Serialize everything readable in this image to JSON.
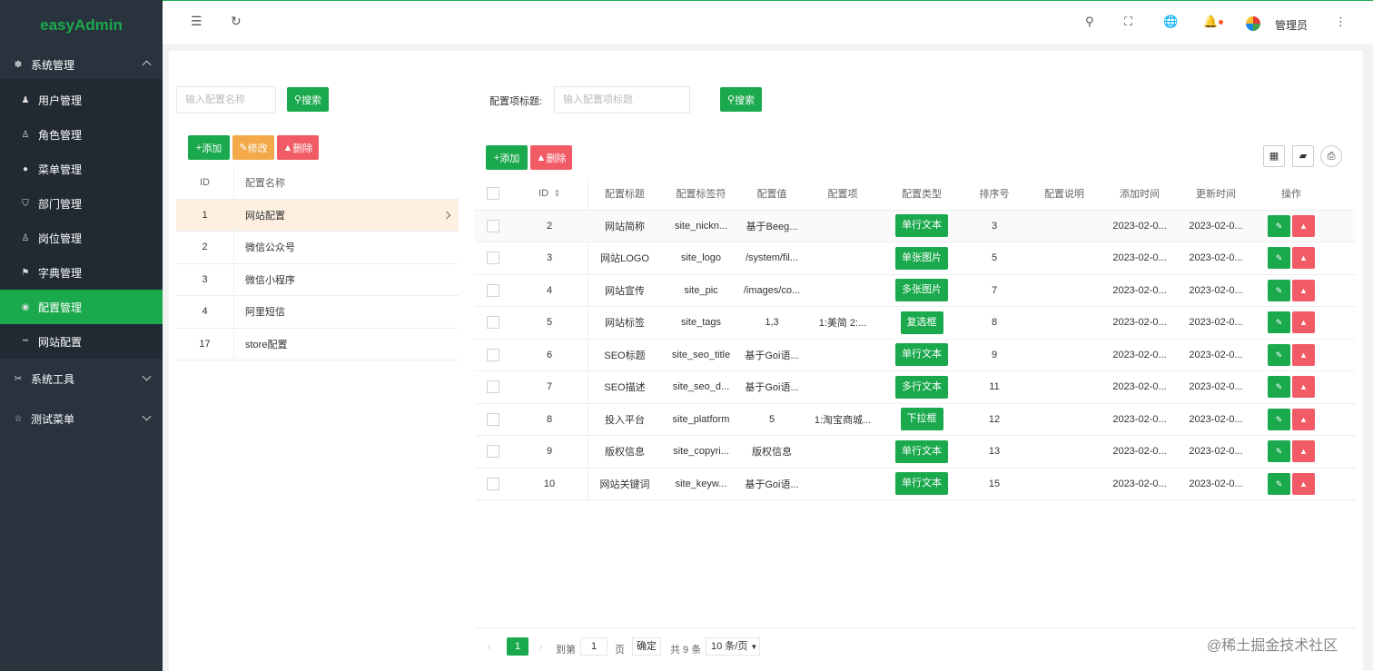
{
  "app": {
    "logo": "easyAdmin"
  },
  "sidebar": {
    "groups": [
      {
        "label": "系统管理",
        "icon": "gear-icon",
        "glyph": "✽",
        "expanded": true,
        "items": [
          {
            "label": "用户管理",
            "icon": "user-icon",
            "glyph": "👤"
          },
          {
            "label": "角色管理",
            "icon": "role-icon",
            "glyph": "♙"
          },
          {
            "label": "菜单管理",
            "icon": "menu-icon",
            "glyph": "●"
          },
          {
            "label": "部门管理",
            "icon": "shield-icon",
            "glyph": "⛉"
          },
          {
            "label": "岗位管理",
            "icon": "post-icon",
            "glyph": "♙"
          },
          {
            "label": "字典管理",
            "icon": "flag-icon",
            "glyph": "⚑"
          },
          {
            "label": "配置管理",
            "icon": "settings-icon",
            "glyph": "◉",
            "active": true
          },
          {
            "label": "网站配置",
            "icon": "dots-icon",
            "glyph": "•••"
          }
        ]
      },
      {
        "label": "系统工具",
        "icon": "tools-icon",
        "glyph": "✂",
        "expanded": false
      },
      {
        "label": "测试菜单",
        "icon": "star-icon",
        "glyph": "☆",
        "expanded": false
      }
    ]
  },
  "header": {
    "admin_name": "管理员"
  },
  "left_panel": {
    "search_placeholder": "输入配置名称",
    "search_btn": "搜索",
    "add_btn": "添加",
    "edit_btn": "修改",
    "delete_btn": "删除",
    "columns": [
      "ID",
      "配置名称"
    ],
    "rows": [
      {
        "id": "1",
        "name": "网站配置",
        "selected": true
      },
      {
        "id": "2",
        "name": "微信公众号"
      },
      {
        "id": "3",
        "name": "微信小程序"
      },
      {
        "id": "4",
        "name": "阿里短信"
      },
      {
        "id": "17",
        "name": "store配置"
      }
    ]
  },
  "right_panel": {
    "filter_label": "配置项标题:",
    "filter_placeholder": "输入配置项标题",
    "search_btn": "搜索",
    "add_btn": "添加",
    "delete_btn": "删除",
    "columns": [
      "ID",
      "配置标题",
      "配置标签符",
      "配置值",
      "配置项",
      "配置类型",
      "排序号",
      "配置说明",
      "添加时间",
      "更新时间",
      "操作"
    ],
    "rows": [
      {
        "id": "2",
        "title": "网站简称",
        "tag": "site_nickn...",
        "value": "基于Beeg...",
        "item": "",
        "type": "单行文本",
        "sort": "3",
        "desc": "",
        "added": "2023-02-0...",
        "updated": "2023-02-0..."
      },
      {
        "id": "3",
        "title": "网站LOGO",
        "tag": "site_logo",
        "value": "/system/fil...",
        "item": "",
        "type": "单张图片",
        "sort": "5",
        "desc": "",
        "added": "2023-02-0...",
        "updated": "2023-02-0..."
      },
      {
        "id": "4",
        "title": "网站宣传",
        "tag": "site_pic",
        "value": "/images/co...",
        "item": "",
        "type": "多张图片",
        "sort": "7",
        "desc": "",
        "added": "2023-02-0...",
        "updated": "2023-02-0..."
      },
      {
        "id": "5",
        "title": "网站标签",
        "tag": "site_tags",
        "value": "1,3",
        "item": "1:美简 2:...",
        "type": "复选框",
        "sort": "8",
        "desc": "",
        "added": "2023-02-0...",
        "updated": "2023-02-0..."
      },
      {
        "id": "6",
        "title": "SEO标题",
        "tag": "site_seo_title",
        "value": "基于Goi语...",
        "item": "",
        "type": "单行文本",
        "sort": "9",
        "desc": "",
        "added": "2023-02-0...",
        "updated": "2023-02-0..."
      },
      {
        "id": "7",
        "title": "SEO描述",
        "tag": "site_seo_d...",
        "value": "基于Goi语...",
        "item": "",
        "type": "多行文本",
        "sort": "11",
        "desc": "",
        "added": "2023-02-0...",
        "updated": "2023-02-0..."
      },
      {
        "id": "8",
        "title": "投入平台",
        "tag": "site_platform",
        "value": "5",
        "item": "1:淘宝商城...",
        "type": "下拉框",
        "sort": "12",
        "desc": "",
        "added": "2023-02-0...",
        "updated": "2023-02-0..."
      },
      {
        "id": "9",
        "title": "版权信息",
        "tag": "site_copyri...",
        "value": "版权信息",
        "item": "",
        "type": "单行文本",
        "sort": "13",
        "desc": "",
        "added": "2023-02-0...",
        "updated": "2023-02-0..."
      },
      {
        "id": "10",
        "title": "网站关键词",
        "tag": "site_keyw...",
        "value": "基于Goi语...",
        "item": "",
        "type": "单行文本",
        "sort": "15",
        "desc": "",
        "added": "2023-02-0...",
        "updated": "2023-02-0..."
      }
    ]
  },
  "pager": {
    "current_page": "1",
    "goto_label": "到第",
    "goto_value": "1",
    "page_label": "页",
    "confirm_btn": "确定",
    "total": "共 9 条",
    "page_size": "10 条/页"
  },
  "watermark": "@稀土掘金技术社区"
}
